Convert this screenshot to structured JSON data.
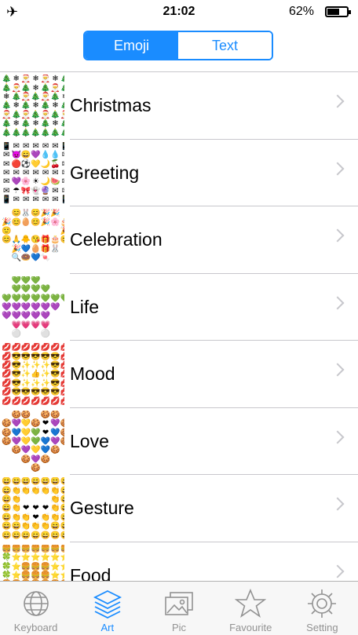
{
  "status": {
    "time": "21:02",
    "battery_pct": "62%",
    "battery_level": 0.62
  },
  "segment": {
    "emoji": "Emoji",
    "text": "Text",
    "selected": "Emoji"
  },
  "categories": [
    {
      "label": "Christmas",
      "thumb": [
        "🎄",
        "❄",
        "🎅",
        "❄",
        "🎅",
        "❄",
        "🎄",
        "🎄",
        "🎅",
        "🎄",
        "❄",
        "🎄",
        "🎅",
        "🎄",
        "❄",
        "🎄",
        "🎅",
        "🎄",
        "🎅",
        "🎄",
        "❄",
        "🎄",
        "❄",
        "🎄",
        "❄",
        "🎄",
        "❄",
        "🎄",
        "🎅",
        "🎄",
        "🎅",
        "🎄",
        "🎅",
        "🎄",
        "🎅",
        "🎄",
        "❄",
        "🎄",
        "❄",
        "🎄",
        "❄",
        "🎄",
        "🎄",
        "🎄",
        "🎄",
        "🎄",
        "🎄",
        "🎄",
        "🎄"
      ]
    },
    {
      "label": "Greeting",
      "thumb": [
        "📱",
        "✉",
        "✉",
        "✉",
        "✉",
        "✉",
        "📱",
        "✉",
        "😈",
        "😄",
        "💜",
        "💧",
        "💧",
        "✉",
        "✉",
        "🔴",
        "⚽",
        "💛",
        "🌙",
        "🍒",
        "✉",
        "✉",
        "✉",
        "✉",
        "✉",
        "✉",
        "✉",
        "✉",
        "✉",
        "💜",
        "🌸",
        "☀",
        "🌙",
        "🍉",
        "✉",
        "✉",
        "☂",
        "🎀",
        "👻",
        "🔮",
        "✉",
        "✉",
        "📱",
        "✉",
        "✉",
        "✉",
        "✉",
        "✉",
        "📱"
      ]
    },
    {
      "label": "Celebration",
      "thumb": [
        "",
        "😊",
        "🐰",
        "😊",
        "🎉",
        "🎉",
        "",
        "🎉",
        "😊",
        "🥚",
        "😊",
        "🎉",
        "🌸",
        "🎂",
        "🙂",
        "",
        "",
        "",
        "",
        "",
        "🎉",
        "😊",
        "🙏",
        "🐥",
        "😘",
        "🎁",
        "🎂",
        "😊",
        "",
        "🎉",
        "💙",
        "🥚",
        "🎁",
        "🐰",
        "",
        "",
        "🔍",
        "🍩",
        "💙",
        "🍬",
        "",
        "",
        "",
        "",
        "",
        "",
        "",
        "",
        ""
      ]
    },
    {
      "label": "Life",
      "thumb": [
        "",
        "💚",
        "💚",
        "💚",
        "",
        "",
        "",
        "",
        "💚",
        "💚",
        "💚",
        "💚",
        "",
        "",
        "💚",
        "💚",
        "💚",
        "💚",
        "💚",
        "💚",
        "💚",
        "💜",
        "💜",
        "💜",
        "💜",
        "💜",
        "💜",
        "",
        "💜",
        "💜",
        "💜",
        "💜",
        "💜",
        "",
        "",
        "",
        "💗",
        "💗",
        "💗",
        "💗",
        "",
        "",
        "",
        "⚪",
        "",
        "",
        "⚪",
        "",
        ""
      ]
    },
    {
      "label": "Mood",
      "thumb": [
        "💋",
        "💋",
        "💋",
        "💋",
        "💋",
        "💋",
        "💋",
        "💋",
        "😎",
        "😎",
        "😎",
        "😎",
        "😎",
        "💋",
        "💋",
        "😎",
        "✨",
        "✨",
        "✨",
        "😎",
        "💋",
        "💋",
        "😎",
        "✨",
        "👍",
        "✨",
        "😎",
        "💋",
        "💋",
        "😎",
        "✨",
        "✨",
        "✨",
        "😎",
        "💋",
        "💋",
        "😎",
        "😎",
        "😎",
        "😎",
        "😎",
        "💋",
        "💋",
        "💋",
        "💋",
        "💋",
        "💋",
        "💋",
        "💋"
      ]
    },
    {
      "label": "Love",
      "thumb": [
        "",
        "🍪",
        "🍪",
        "",
        "🍪",
        "🍪",
        "",
        "🍪",
        "💜",
        "💛",
        "🍪",
        "❤",
        "💜",
        "🍪",
        "🍪",
        "💙",
        "💛",
        "💚",
        "❤",
        "💙",
        "🍪",
        "🍪",
        "💜",
        "💛",
        "💚",
        "💙",
        "💜",
        "🍪",
        "",
        "🍪",
        "💜",
        "💛",
        "💙",
        "🍪",
        "",
        "",
        "",
        "🍪",
        "💜",
        "🍪",
        "",
        "",
        "",
        "",
        "",
        "🍪",
        "",
        "",
        ""
      ]
    },
    {
      "label": "Gesture",
      "thumb": [
        "😄",
        "😄",
        "😄",
        "😄",
        "😄",
        "😄",
        "😄",
        "😄",
        "👏",
        "👏",
        "👏",
        "👏",
        "👏",
        "😄",
        "😄",
        "👏",
        "",
        "",
        "",
        "👏",
        "😄",
        "😄",
        "👏",
        "❤",
        "❤",
        "❤",
        "👏",
        "😄",
        "😄",
        "👏",
        "👏",
        "❤",
        "👏",
        "👏",
        "😄",
        "😄",
        "😄",
        "👏",
        "👏",
        "👏",
        "😄",
        "😄",
        "😄",
        "😄",
        "😄",
        "😄",
        "😄",
        "😄",
        "😄"
      ]
    },
    {
      "label": "Food",
      "thumb": [
        "🍔",
        "🍔",
        "🍔",
        "🍔",
        "🍔",
        "🍔",
        "🍔",
        "🍀",
        "⭐",
        "⭐",
        "⭐",
        "⭐",
        "⭐",
        "⭐",
        "🍀",
        "⭐",
        "🍔",
        "🍔",
        "🍔",
        "⭐",
        "⭐",
        "🍀",
        "⭐",
        "🍔",
        "🍔",
        "🍔",
        "⭐",
        "⭐",
        "🍔",
        "🍔",
        "🍔",
        "🍔",
        "🍔",
        "🍔",
        "🍔",
        "",
        "",
        "",
        "",
        "",
        "",
        "",
        "",
        "",
        "",
        "",
        "",
        "",
        ""
      ]
    }
  ],
  "tabs": [
    {
      "label": "Keyboard",
      "icon": "globe-icon",
      "active": false
    },
    {
      "label": "Art",
      "icon": "layers-icon",
      "active": true
    },
    {
      "label": "Pic",
      "icon": "pictures-icon",
      "active": false
    },
    {
      "label": "Favourite",
      "icon": "star-icon",
      "active": false
    },
    {
      "label": "Setting",
      "icon": "gear-icon",
      "active": false
    }
  ],
  "colors": {
    "accent": "#1a8cff",
    "inactive": "#929292",
    "separator": "#c8c7cc"
  }
}
